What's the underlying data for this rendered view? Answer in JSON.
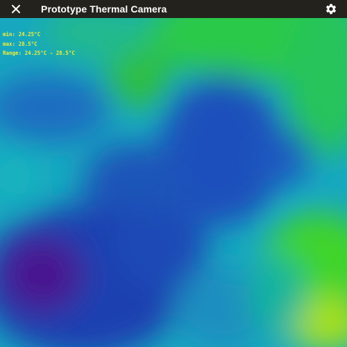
{
  "appbar": {
    "title": "Prototype Thermal Camera",
    "close_icon": "close-icon",
    "settings_icon": "gear-icon",
    "background_color": "#24221d"
  },
  "readout": {
    "min_label": "min:",
    "min_value": "24.25°C",
    "max_label": "max:",
    "max_value": "28.5°C",
    "range_label": "Range:",
    "range_value": "24.25°C - 28.5°C",
    "text_color": "#f2ee3a"
  },
  "palette": {
    "coldest": "#4a1590",
    "cold": "#1a3fb0",
    "mid": "#17b9c3",
    "warm": "#2ed33a",
    "hottest": "#9be21a"
  }
}
